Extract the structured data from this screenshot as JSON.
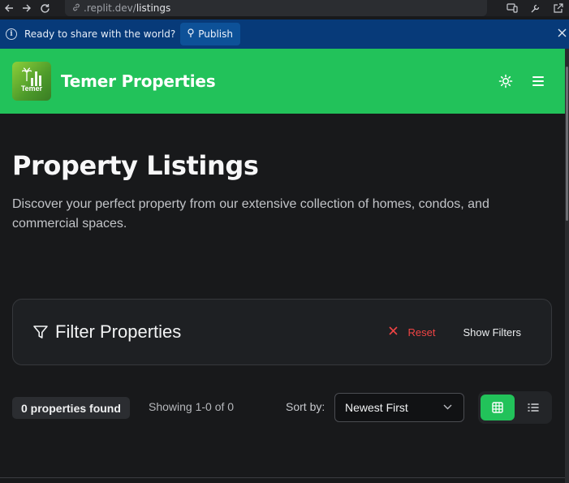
{
  "browser": {
    "url_host": ".replit.dev/",
    "url_path": "listings",
    "back_icon": "arrow-left-icon",
    "forward_icon": "arrow-right-icon",
    "reload_icon": "reload-icon"
  },
  "share_bar": {
    "message": "Ready to share with the world?",
    "publish_label": "Publish"
  },
  "header": {
    "brand": "Temer Properties",
    "logo_text": "Temer",
    "accent_color": "#22c25a"
  },
  "main": {
    "title": "Property Listings",
    "description": "Discover your perfect property from our extensive collection of homes, condos, and commercial spaces."
  },
  "filters": {
    "title": "Filter Properties",
    "reset_label": "Reset",
    "show_filters_label": "Show Filters"
  },
  "results": {
    "count_label": "0 properties found",
    "showing_label": "Showing 1-0 of 0",
    "sort_label": "Sort by:",
    "sort_value": "Newest First",
    "active_view": "grid"
  }
}
